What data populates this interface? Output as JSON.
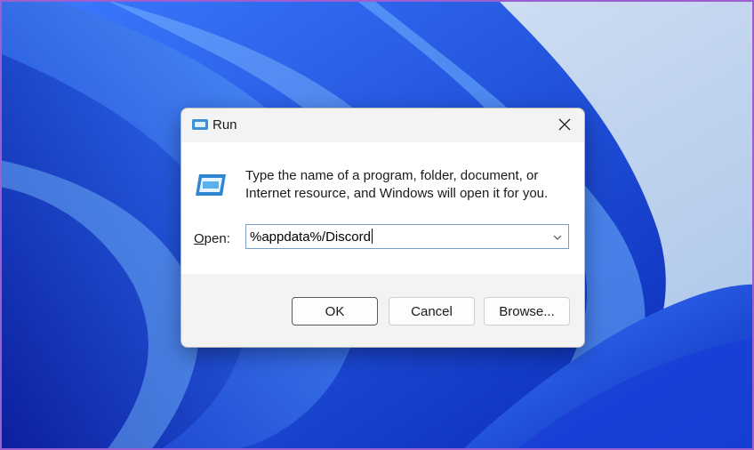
{
  "dialog": {
    "title": "Run",
    "description": "Type the name of a program, folder, document, or Internet resource, and Windows will open it for you.",
    "open_label_accel": "O",
    "open_label_rest": "pen:",
    "input_value": "%appdata%/Discord",
    "buttons": {
      "ok": "OK",
      "cancel": "Cancel",
      "browse": "Browse..."
    }
  },
  "icons": {
    "title": "run-app-icon",
    "close": "close-icon",
    "dropdown": "chevron-down-icon"
  },
  "colors": {
    "wallpaper_blue": "#1e4fe0",
    "wallpaper_light": "#c8daf0",
    "dialog_bg": "#ffffff",
    "footer_bg": "#f3f3f3",
    "input_border": "#7a9cc6"
  }
}
